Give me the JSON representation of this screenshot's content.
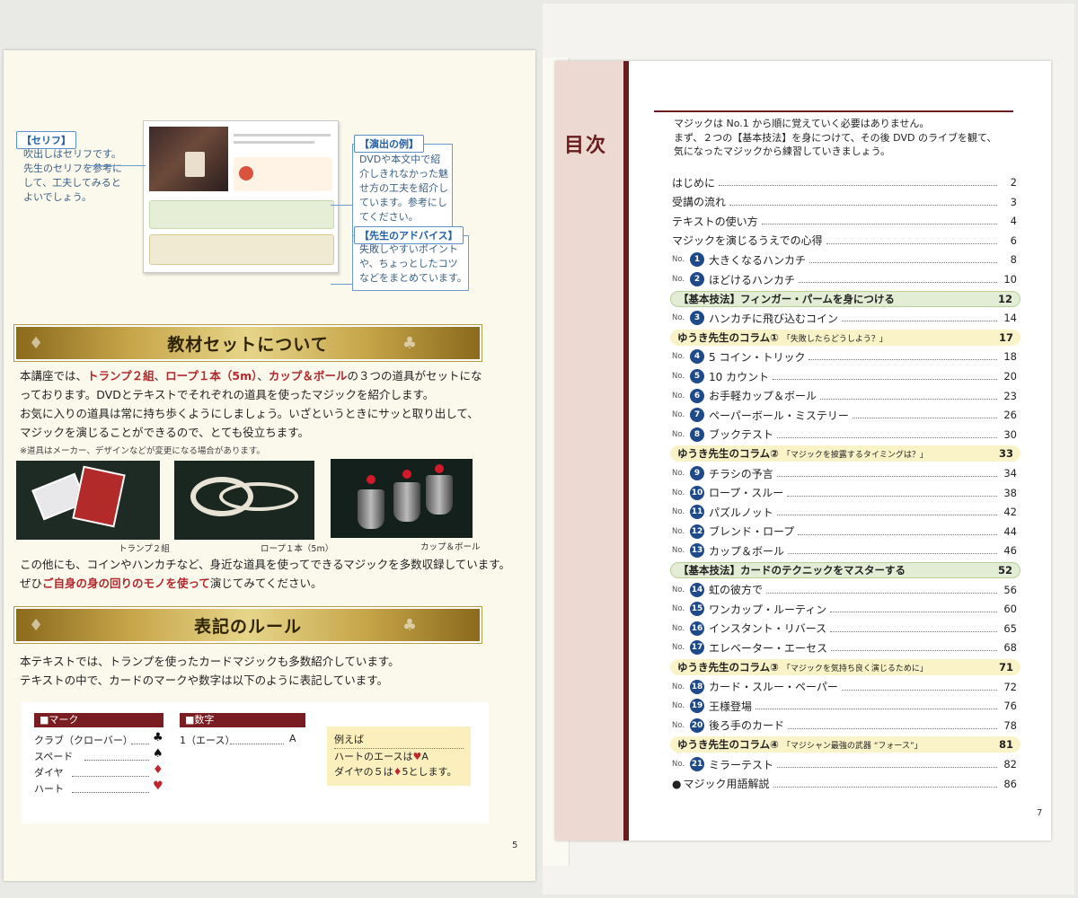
{
  "left_page": {
    "callouts": {
      "serifu": {
        "tag": "【セリフ】",
        "text": [
          "吹出しはセリフです。",
          "先生のセリフを参考に",
          "して、工夫してみると",
          "よいでしょう。"
        ]
      },
      "enshutsu": {
        "tag": "【演出の例】",
        "text": [
          "DVDや本文中で紹",
          "介しきれなかった魅",
          "せ方の工夫を紹介し",
          "ています。参考にし",
          "てください。"
        ]
      },
      "advice": {
        "tag": "【先生のアドバイス】",
        "text": [
          "失敗しやすいポイント",
          "や、ちょっとしたコツ",
          "などをまとめています。"
        ]
      }
    },
    "section1": {
      "title": "教材セットについて",
      "para1_parts": [
        "本講座では、",
        "トランプ２組",
        "、",
        "ロープ１本（5m）",
        "、",
        "カップ＆ボール",
        "の３つの道具がセットにな"
      ],
      "para1_rest": [
        "っております。DVDとテキストでそれぞれの道具を使ったマジックを紹介します。",
        "お気に入りの道具は常に持ち歩くようにしましょう。いざというときにサッと取り出して、",
        "マジックを演じることができるので、とても役立ちます。"
      ],
      "note": "※道具はメーカー、デザインなどが変更になる場合があります。",
      "captions": [
        "トランプ２組",
        "ロープ１本（5m）",
        "カップ＆ボール"
      ],
      "para2_line1": "この他にも、コインやハンカチなど、身近な道具を使ってできるマジックを多数収録しています。",
      "para2_pre": "ぜひ",
      "para2_red": "ご自身の身の回りのモノを使って",
      "para2_post": "演じてみてください。"
    },
    "section2": {
      "title": "表記のルール",
      "para": [
        "本テキストでは、トランプを使ったカードマジックも多数紹介しています。",
        "テキストの中で、カードのマークや数字は以下のように表記しています。"
      ],
      "mark_head": "■マーク",
      "marks": [
        {
          "label": "クラブ（クローバー）",
          "symbol": "♣",
          "color": "#111111"
        },
        {
          "label": "スペード",
          "symbol": "♠",
          "color": "#111111"
        },
        {
          "label": "ダイヤ",
          "symbol": "♦",
          "color": "#c0262d"
        },
        {
          "label": "ハート",
          "symbol": "♥",
          "color": "#c0262d"
        }
      ],
      "number_head": "■数字",
      "number_line": {
        "label": "1（エース）",
        "value": "A"
      },
      "example": {
        "title": "例えば",
        "line1_pre": "ハートのエースは",
        "line1_suit": "♥",
        "line1_post": "A",
        "line2_pre": "ダイヤの５は",
        "line2_suit": "♦",
        "line2_post": "5とします。"
      }
    },
    "page_number": "5"
  },
  "right_page": {
    "title": "目次",
    "intro": [
      "マジックは No.1 から順に覚えていく必要はありません。",
      "まず、２つの【基本技法】を身につけて、その後 DVD のライブを観て、",
      "気になったマジックから練習していきましょう。"
    ],
    "entries": [
      {
        "kind": "plain",
        "title": "はじめに",
        "page": "2"
      },
      {
        "kind": "plain",
        "title": "受講の流れ",
        "page": "3"
      },
      {
        "kind": "plain",
        "title": "テキストの使い方",
        "page": "4"
      },
      {
        "kind": "plain",
        "title": "マジックを演じるうえでの心得",
        "page": "6"
      },
      {
        "kind": "no",
        "no_label": "No.",
        "num": "1",
        "title": "大きくなるハンカチ",
        "page": "8"
      },
      {
        "kind": "no",
        "no_label": "No.",
        "num": "2",
        "title": "ほどけるハンカチ",
        "page": "10"
      },
      {
        "kind": "green",
        "title": "【基本技法】フィンガー・パームを身につける",
        "page": "12"
      },
      {
        "kind": "no",
        "no_label": "No.",
        "num": "3",
        "title": "ハンカチに飛び込むコイン",
        "page": "14"
      },
      {
        "kind": "yellow",
        "title": "ゆうき先生のコラム①",
        "sub": "「失敗したらどうしよう？」",
        "page": "17"
      },
      {
        "kind": "no",
        "no_label": "No.",
        "num": "4",
        "title": "5 コイン・トリック",
        "page": "18"
      },
      {
        "kind": "no",
        "no_label": "No.",
        "num": "5",
        "title": "10 カウント",
        "page": "20"
      },
      {
        "kind": "no",
        "no_label": "No.",
        "num": "6",
        "title": "お手軽カップ＆ボール",
        "page": "23"
      },
      {
        "kind": "no",
        "no_label": "No.",
        "num": "7",
        "title": "ペーパーボール・ミステリー",
        "page": "26"
      },
      {
        "kind": "no",
        "no_label": "No.",
        "num": "8",
        "title": "ブックテスト",
        "page": "30"
      },
      {
        "kind": "yellow",
        "title": "ゆうき先生のコラム②",
        "sub": "「マジックを披露するタイミングは？」",
        "page": "33"
      },
      {
        "kind": "no",
        "no_label": "No.",
        "num": "9",
        "title": "チラシの予言",
        "page": "34"
      },
      {
        "kind": "no",
        "no_label": "No.",
        "num": "10",
        "title": "ロープ・スルー",
        "page": "38"
      },
      {
        "kind": "no",
        "no_label": "No.",
        "num": "11",
        "title": "パズルノット",
        "page": "42"
      },
      {
        "kind": "no",
        "no_label": "No.",
        "num": "12",
        "title": "ブレンド・ロープ",
        "page": "44"
      },
      {
        "kind": "no",
        "no_label": "No.",
        "num": "13",
        "title": "カップ＆ボール",
        "page": "46"
      },
      {
        "kind": "green",
        "title": "【基本技法】カードのテクニックをマスターする",
        "page": "52"
      },
      {
        "kind": "no",
        "no_label": "No.",
        "num": "14",
        "title": "虹の彼方で",
        "page": "56"
      },
      {
        "kind": "no",
        "no_label": "No.",
        "num": "15",
        "title": "ワンカップ・ルーティン",
        "page": "60"
      },
      {
        "kind": "no",
        "no_label": "No.",
        "num": "16",
        "title": "インスタント・リバース",
        "page": "65"
      },
      {
        "kind": "no",
        "no_label": "No.",
        "num": "17",
        "title": "エレベーター・エーセス",
        "page": "68"
      },
      {
        "kind": "yellow",
        "title": "ゆうき先生のコラム③",
        "sub": "「マジックを気持ち良く演じるために」",
        "page": "71"
      },
      {
        "kind": "no",
        "no_label": "No.",
        "num": "18",
        "title": "カード・スルー・ペーパー",
        "page": "72"
      },
      {
        "kind": "no",
        "no_label": "No.",
        "num": "19",
        "title": "王様登場",
        "page": "76"
      },
      {
        "kind": "no",
        "no_label": "No.",
        "num": "20",
        "title": "後ろ手のカード",
        "page": "78"
      },
      {
        "kind": "yellow",
        "title": "ゆうき先生のコラム④",
        "sub": "「マジシャン最強の武器 “フォース”」",
        "page": "81"
      },
      {
        "kind": "no",
        "no_label": "No.",
        "num": "21",
        "title": "ミラーテスト",
        "page": "82"
      },
      {
        "kind": "bullet",
        "bullet": "●",
        "title": "マジック用語解説",
        "page": "86"
      }
    ],
    "page_number": "7"
  },
  "colors": {
    "accent_red": "#6a1c1f",
    "circle_blue": "#1f4a8a",
    "banner_gold": "#c7a64a"
  }
}
